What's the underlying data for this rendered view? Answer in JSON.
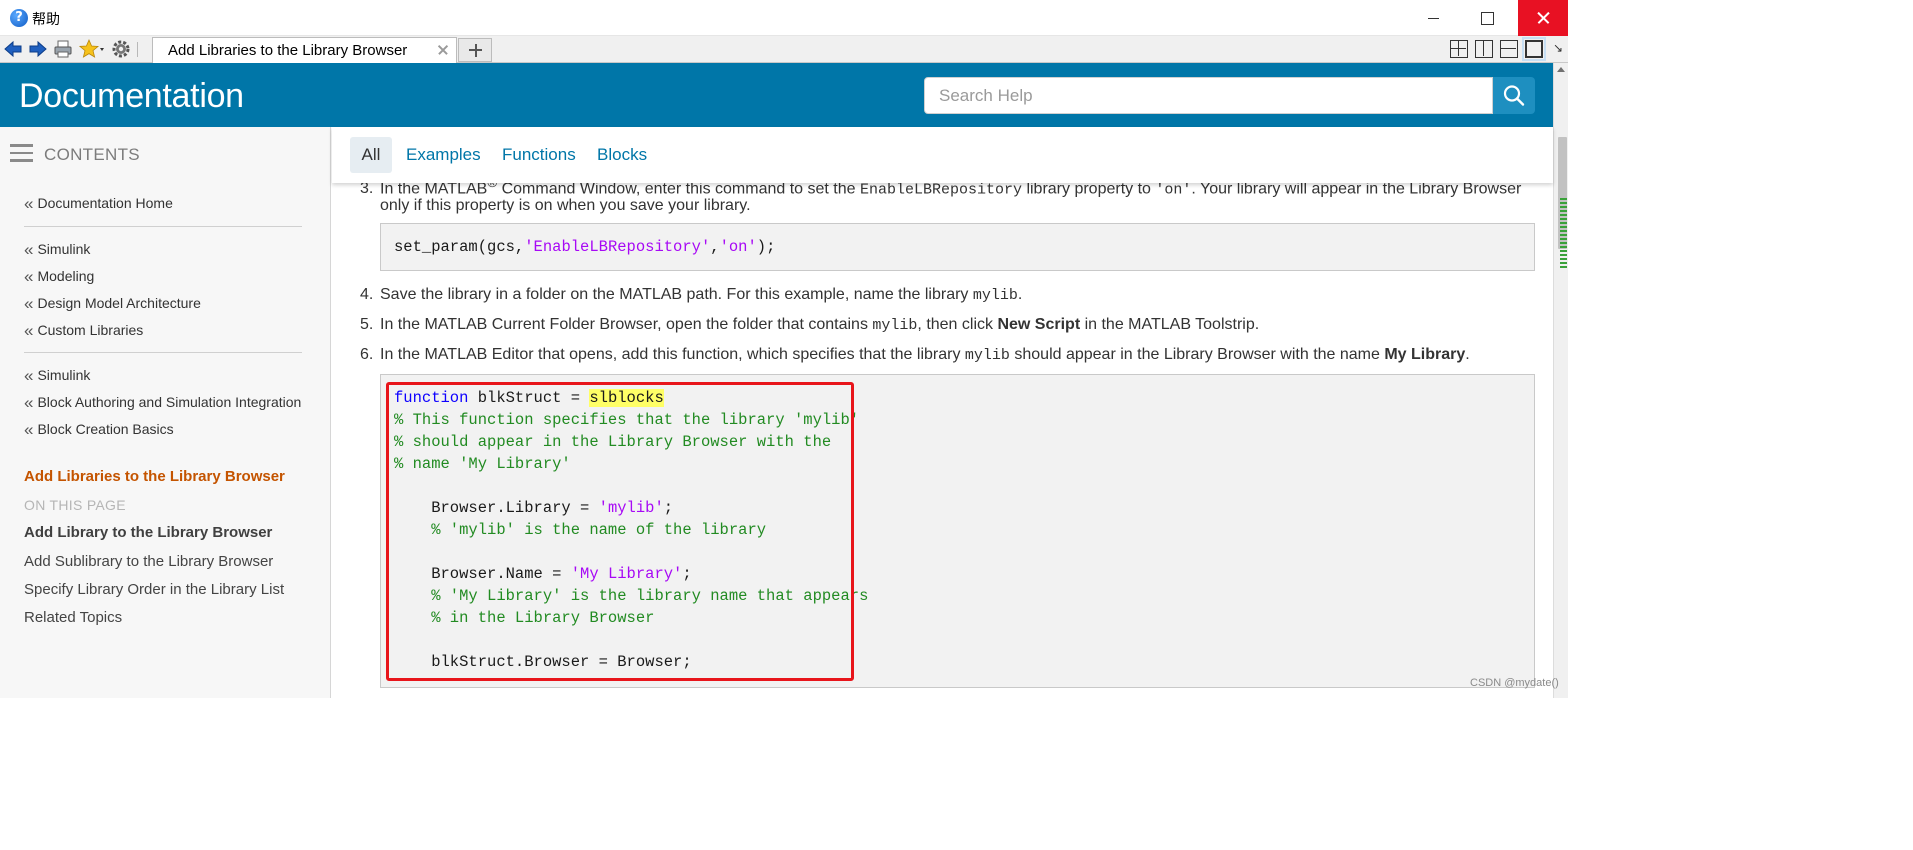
{
  "window": {
    "title": "帮助",
    "app_icon": "help-question-icon"
  },
  "browser": {
    "tab_label": "Add Libraries to the Library Browser",
    "toolbar_icons": [
      "back-arrow-icon",
      "forward-arrow-icon",
      "print-icon",
      "favorites-star-icon",
      "settings-gear-icon"
    ],
    "layout_icons": [
      "grid-layout-icon",
      "vertical-split-icon",
      "horizontal-split-icon",
      "single-view-icon"
    ]
  },
  "header": {
    "title": "Documentation",
    "search_placeholder": "Search Help",
    "background_color": "#0076a8"
  },
  "sidebar": {
    "contents_label": "CONTENTS",
    "breadcrumb_groups": [
      [
        "Documentation Home"
      ],
      [
        "Simulink",
        "Modeling",
        "Design Model Architecture",
        "Custom Libraries"
      ],
      [
        "Simulink",
        "Block Authoring and Simulation Integration",
        "Block Creation Basics"
      ]
    ],
    "current_page": "Add Libraries to the Library Browser",
    "on_this_page_label": "ON THIS PAGE",
    "page_sections": [
      "Add Library to the Library Browser",
      "Add Sublibrary to the Library Browser",
      "Specify Library Order in the Library List",
      "Related Topics"
    ]
  },
  "filters": [
    "All",
    "Examples",
    "Functions",
    "Blocks"
  ],
  "content": {
    "step3": {
      "num": "3.",
      "text_a": "In the MATLAB",
      "sup": "®",
      "text_b": " Command Window, enter this command to set the ",
      "code": "EnableLBRepository",
      "text_c": " library property to ",
      "value": "'on'",
      "text_d": ". Your library will appear in the Library Browser",
      "line2": "only if this property is on when you save your library."
    },
    "cmd": {
      "prefix": "set_param(gcs,",
      "arg1": "'EnableLBRepository'",
      "comma": ",",
      "arg2": "'on'",
      "suffix": ");"
    },
    "step4": {
      "num": "4.",
      "text": "Save the library in a folder on the MATLAB path. For this example, name the library ",
      "code": "mylib",
      "end": "."
    },
    "step5": {
      "num": "5.",
      "text_a": "In the MATLAB Current Folder Browser, open the folder that contains ",
      "code": "mylib",
      "text_b": ", then click ",
      "bold": "New Script",
      "text_c": " in the MATLAB Toolstrip."
    },
    "step6": {
      "num": "6.",
      "text_a": "In the MATLAB Editor that opens, add this function, which specifies that the library ",
      "code": "mylib",
      "text_b": " should appear in the Library Browser with the name ",
      "bold": "My Library",
      "end": "."
    },
    "code": {
      "l1_kw": "function",
      "l1_mid": " blkStruct = ",
      "l1_fn": "slblocks",
      "l2": "% This function specifies that the library 'mylib'",
      "l3": "% should appear in the Library Browser with the",
      "l4": "% name 'My Library'",
      "l5_a": "    Browser.Library = ",
      "l5_str": "'mylib'",
      "l5_end": ";",
      "l6": "    % 'mylib' is the name of the library",
      "l7_a": "    Browser.Name = ",
      "l7_str": "'My Library'",
      "l7_end": ";",
      "l8": "    % 'My Library' is the library name that appears",
      "l9": "    % in the Library Browser",
      "l10": "    blkStruct.Browser = Browser;"
    },
    "highlight_color": "#e8151b"
  },
  "watermark": "CSDN @mydate()"
}
